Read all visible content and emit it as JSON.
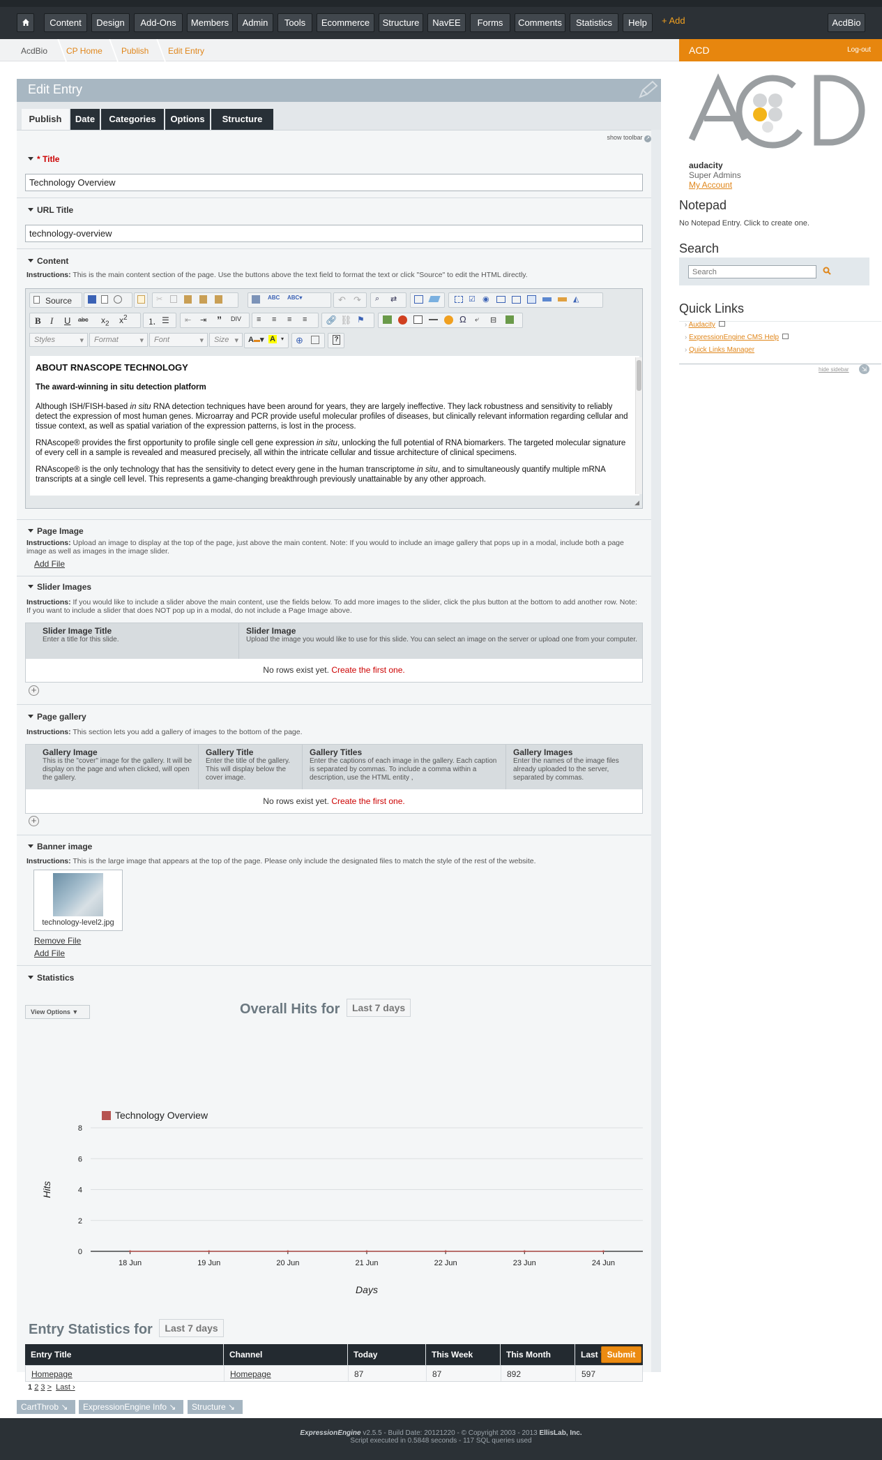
{
  "nav": {
    "items": [
      "Content",
      "Design",
      "Add-Ons",
      "Members",
      "Admin",
      "Tools",
      "Ecommerce",
      "Structure",
      "NavEE",
      "Forms",
      "Comments",
      "Statistics",
      "Help"
    ],
    "add": "+ Add",
    "site": "AcdBio"
  },
  "breadcrumb": [
    "AcdBio",
    "CP Home",
    "Publish",
    "Edit Entry"
  ],
  "sidebar": {
    "site": "ACD",
    "logout": "Log-out",
    "username": "audacity",
    "role": "Super Admins",
    "my_account": "My Account",
    "notepad_title": "Notepad",
    "notepad_text": "No Notepad Entry. Click to create one.",
    "search_title": "Search",
    "search_placeholder": "Search",
    "quicklinks_title": "Quick Links",
    "quicklinks": [
      "Audacity",
      "ExpressionEngine CMS Help",
      "Quick Links Manager"
    ],
    "hide_sidebar": "hide sidebar"
  },
  "edit": {
    "title": "Edit Entry",
    "tabs": [
      "Publish",
      "Date",
      "Categories",
      "Options",
      "Structure"
    ],
    "show_toolbar": "show toolbar",
    "title_label": "* Title",
    "title_value": "Technology Overview",
    "url_label": "URL Title",
    "url_value": "technology-overview",
    "content_label": "Content",
    "instructions_prefix": "Instructions:",
    "content_instr": "This is the main content section of the page. Use the buttons above the text field to format the text or click \"Source\" to edit the HTML directly.",
    "source_btn": "Source",
    "styles": "Styles",
    "format": "Format",
    "font": "Font",
    "size": "Size",
    "body": {
      "h": "ABOUT RNASCOPE TECHNOLOGY",
      "sub": "The award-winning in situ detection platform",
      "p1a": "Although ISH/FISH-based ",
      "p1i": "in situ",
      "p1b": " RNA detection techniques have been around for years, they are largely ineffective. They lack robustness and sensitivity to reliably detect the expression of most human genes. Microarray and PCR provide useful molecular profiles of diseases, but clinically relevant information regarding cellular and tissue context, as well as spatial variation of the expression patterns, is lost in the process.",
      "p2a": "RNAscope® provides the first opportunity to profile single cell gene expression ",
      "p2i": "in situ",
      "p2b": ", unlocking the full potential of RNA biomarkers. The targeted molecular signature of every cell in a sample is revealed and measured precisely, all within the intricate cellular and tissue architecture of clinical specimens.",
      "p3a": "RNAscope® is the only technology that has the sensitivity to detect every gene in the human transcriptome ",
      "p3i": "in situ",
      "p3b": ", and to simultaneously quantify multiple mRNA transcripts at a single cell level. This represents a game-changing breakthrough previously unattainable by any other approach."
    },
    "page_image_label": "Page Image",
    "page_image_instr": "Upload an image to display at the top of the page, just above the main content. Note: If you would to include an image gallery that pops up in a modal, include both a page image as well as images in the image slider.",
    "add_file": "Add File",
    "slider_label": "Slider Images",
    "slider_instr": "If you would like to include a slider above the main content, use the fields below. To add more images to the slider, click the plus button at the bottom to add another row. Note: If you want to include a slider that does NOT pop up in a modal, do not include a Page Image above.",
    "slider_cols": [
      {
        "title": "Slider Image Title",
        "desc": "Enter a title for this slide."
      },
      {
        "title": "Slider Image",
        "desc": "Upload the image you would like to use for this slide. You can select an image on the server or upload one from your computer."
      }
    ],
    "no_rows": "No rows exist yet.",
    "create_first": "Create the first one.",
    "gallery_label": "Page gallery",
    "gallery_instr": "This section lets you add a gallery of images to the bottom of the page.",
    "gallery_cols": [
      {
        "title": "Gallery Image",
        "desc": "This is the \"cover\" image for the gallery. It will be display on the page and when clicked, will open the gallery."
      },
      {
        "title": "Gallery Title",
        "desc": "Enter the title of the gallery. This will display below the cover image."
      },
      {
        "title": "Gallery Titles",
        "desc": "Enter the captions of each image in the gallery. Each caption is separated by commas. To include a comma within a description, use the HTML entity ,"
      },
      {
        "title": "Gallery Images",
        "desc": "Enter the names of the image files already uploaded to the server, separated by commas."
      }
    ],
    "banner_label": "Banner image",
    "banner_instr": "This is the large image that appears at the top of the page. Please only include the designated files to match the style of the rest of the website.",
    "banner_file": "technology-level2.jpg",
    "remove_file": "Remove File",
    "stats_label": "Statistics",
    "view_options": "View Options ▼",
    "overall_hits": "Overall Hits for",
    "period": "Last 7 days",
    "entry_stats": "Entry Statistics for",
    "table": {
      "headers": [
        "Entry Title",
        "Channel",
        "Today",
        "This Week",
        "This Month",
        "Last 7 days"
      ],
      "rows": [
        [
          "Homepage",
          "Homepage",
          "87",
          "87",
          "892",
          "597"
        ]
      ]
    },
    "pagination": {
      "current": "1",
      "pages": [
        "2",
        "3",
        ">"
      ],
      "last": "Last ›"
    },
    "submit": "Submit"
  },
  "chart_data": {
    "type": "line",
    "title": "Overall Hits for Last 7 days",
    "xlabel": "Days",
    "ylabel": "Hits",
    "categories": [
      "18 Jun",
      "19 Jun",
      "20 Jun",
      "21 Jun",
      "22 Jun",
      "23 Jun",
      "24 Jun"
    ],
    "series": [
      {
        "name": "Technology Overview",
        "values": [
          0,
          0,
          0,
          0,
          0,
          0,
          0
        ],
        "color": "#b65451"
      }
    ],
    "ylim": [
      0,
      8
    ],
    "yticks": [
      0,
      2,
      4,
      6,
      8
    ],
    "grid": true,
    "legend": "top-left"
  },
  "footer_links": [
    "CartThrob",
    "ExpressionEngine Info",
    "Structure"
  ],
  "footer": {
    "brand": "ExpressionEngine",
    "line1": "v2.5.5 - Build Date: 20121220 - © Copyright 2003 - 2013",
    "company": "EllisLab, Inc.",
    "line2": "Script executed in 0.5848 seconds - 117 SQL queries used"
  },
  "colors": {
    "accent": "#e7860e",
    "nav": "#2c3136",
    "link": "#cc0000"
  }
}
